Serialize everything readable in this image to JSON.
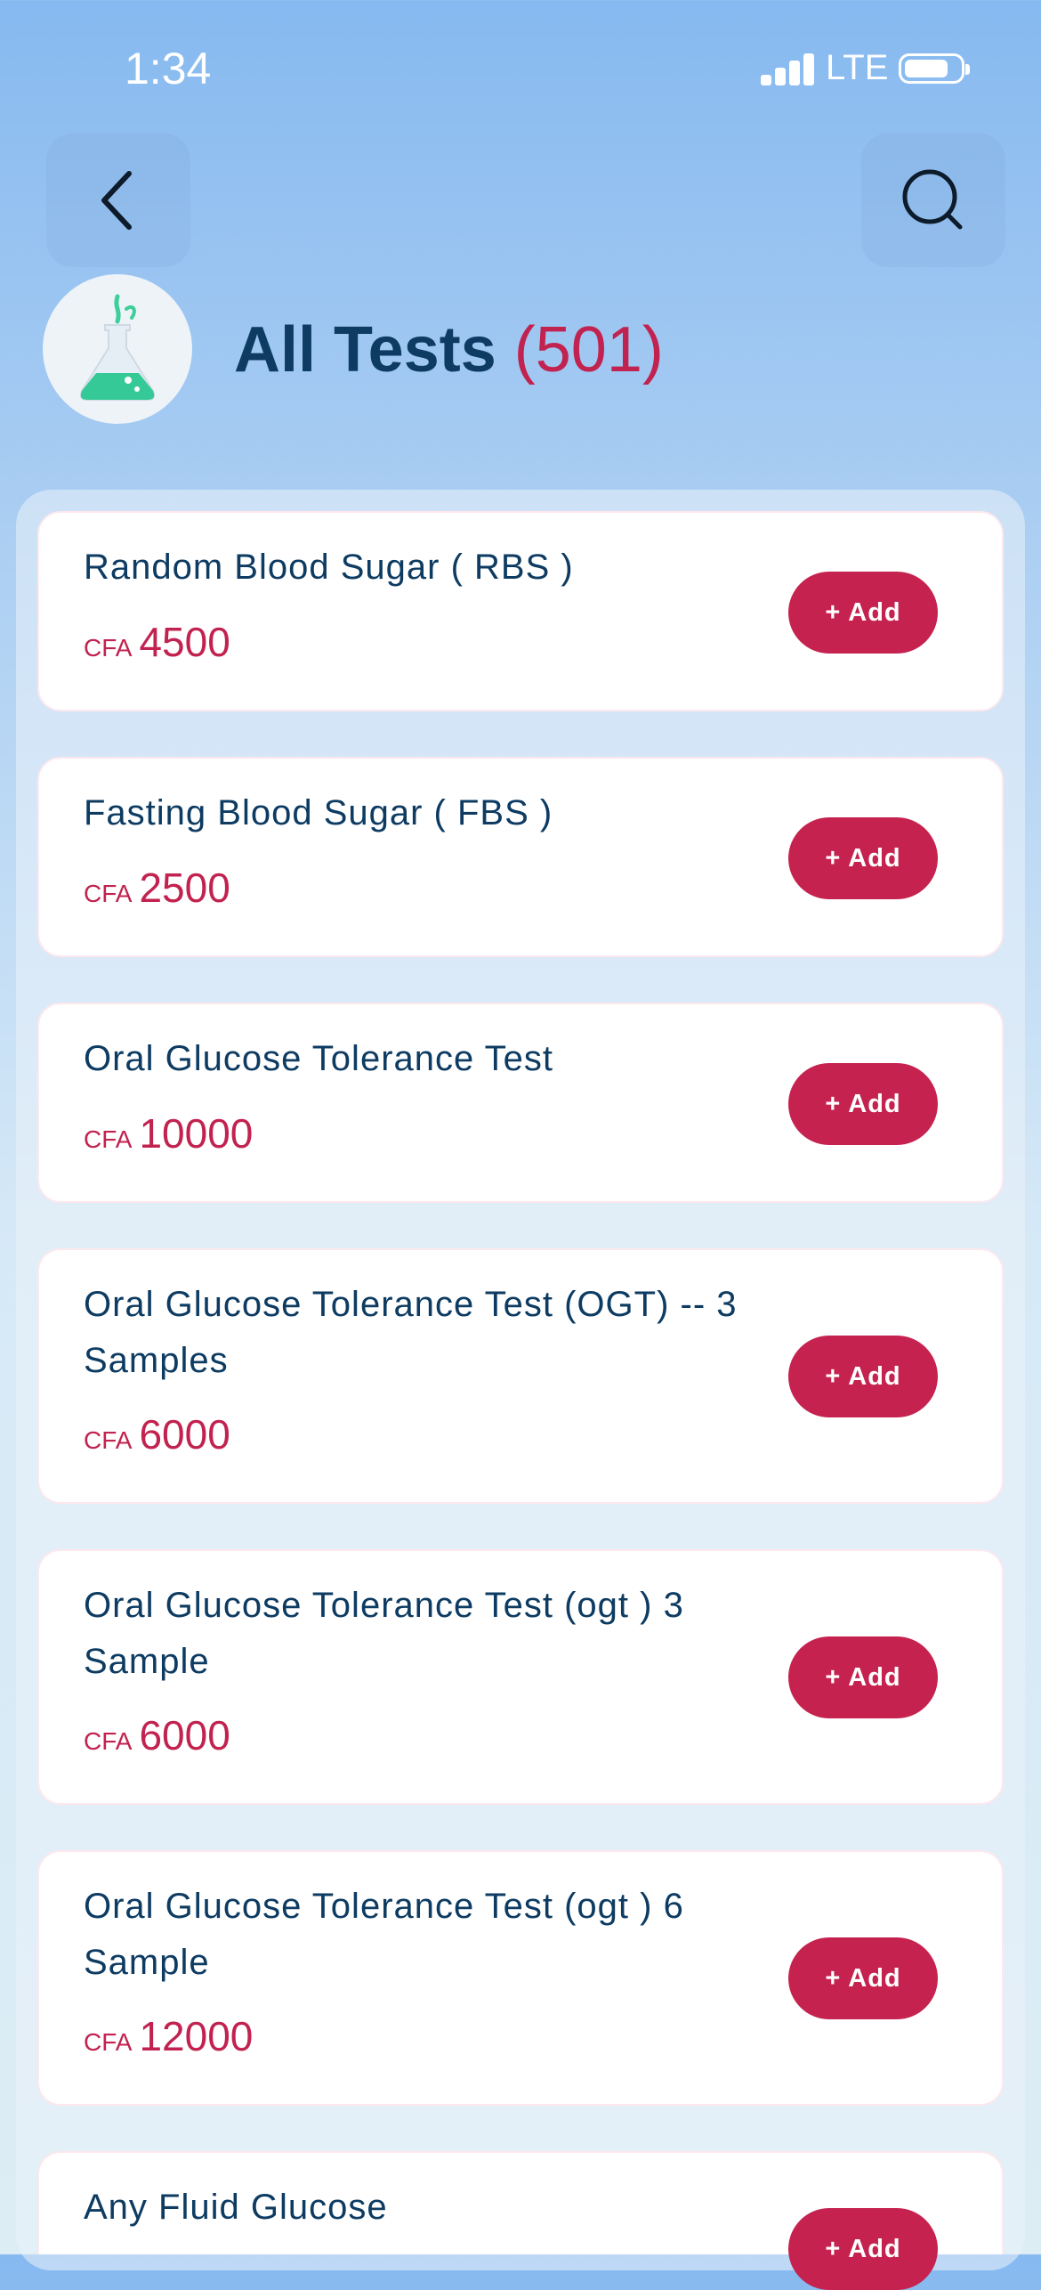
{
  "status_bar": {
    "time": "1:34",
    "network": "LTE"
  },
  "header": {
    "title": "All Tests",
    "count": "(501)"
  },
  "icons": {
    "back": "chevron-left-icon",
    "search": "search-icon",
    "category": "flask-icon"
  },
  "colors": {
    "accent": "#c5224f",
    "title": "#0d3b62"
  },
  "currency": "CFA",
  "add_label": "+ Add",
  "tests": [
    {
      "name": "Random Blood Sugar ( RBS )",
      "price": "4500"
    },
    {
      "name": "Fasting Blood Sugar ( FBS )",
      "price": "2500"
    },
    {
      "name": "Oral Glucose Tolerance Test",
      "price": "10000"
    },
    {
      "name": "Oral Glucose Tolerance Test (OGT) -- 3 Samples",
      "price": "6000"
    },
    {
      "name": "Oral Glucose Tolerance Test (ogt ) 3 Sample",
      "price": "6000"
    },
    {
      "name": "Oral Glucose Tolerance Test (ogt ) 6 Sample",
      "price": "12000"
    },
    {
      "name": "Any Fluid Glucose",
      "price": ""
    }
  ]
}
